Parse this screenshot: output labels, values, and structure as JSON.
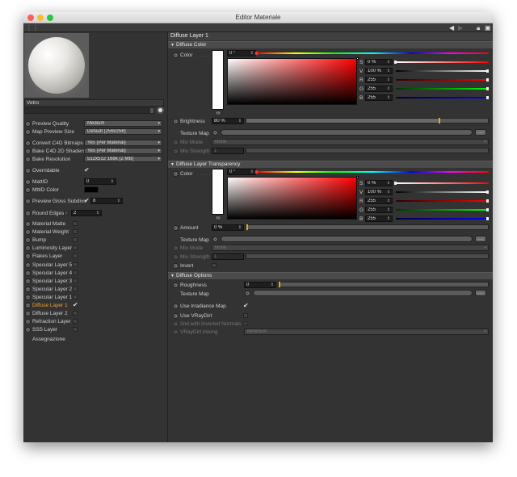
{
  "window": {
    "title": "Editor Materiale"
  },
  "material": {
    "name": "Vetro"
  },
  "left": {
    "preview_quality": {
      "label": "Preview Quality",
      "value": "Medium"
    },
    "map_preview_size": {
      "label": "Map Preview Size",
      "value": "Default (256x256)"
    },
    "convert_bitmaps": {
      "label": "Convert C4D Bitmaps",
      "value": "Yes (Per Material)"
    },
    "bake_shaders": {
      "label": "Bake C4D 2D Shaders",
      "value": "Yes (Per Material)"
    },
    "bake_resolution": {
      "label": "Bake Resolution",
      "value": "512x512    168k    (2 MB)"
    },
    "overridable": {
      "label": "Overridable"
    },
    "mattid": {
      "label": "MattID",
      "value": "0"
    },
    "mattid_color": {
      "label": "MttID Color"
    },
    "preview_gloss": {
      "label": "Preview Gloss Subdivs",
      "value": "8"
    },
    "round_edges": {
      "label": "Round Edges",
      "value": "2"
    },
    "layers": [
      {
        "label": "Material Matte",
        "checked": false,
        "active": false
      },
      {
        "label": "Material Weight",
        "checked": false,
        "active": false
      },
      {
        "label": "Bump",
        "checked": false,
        "active": false
      },
      {
        "label": "Luminosity Layer",
        "checked": false,
        "active": false
      },
      {
        "label": "Flakes Layer",
        "checked": false,
        "active": false
      },
      {
        "label": "Specular Layer 5",
        "checked": false,
        "active": false
      },
      {
        "label": "Specular Layer 4",
        "checked": false,
        "active": false
      },
      {
        "label": "Specular Layer 3",
        "checked": false,
        "active": false
      },
      {
        "label": "Specular Layer 2",
        "checked": false,
        "active": false
      },
      {
        "label": "Specular Layer 1",
        "checked": false,
        "active": false
      },
      {
        "label": "Diffuse Layer 1",
        "checked": true,
        "active": true
      },
      {
        "label": "Diffuse Layer 2",
        "checked": false,
        "active": false
      },
      {
        "label": "Refraction Layer",
        "checked": false,
        "active": false
      },
      {
        "label": "SSS Layer",
        "checked": false,
        "active": false
      }
    ],
    "assignment": "Assegnazione"
  },
  "panel": {
    "title": "Diffuse Layer 1",
    "diffuse_color": {
      "section": "Diffuse Color",
      "color_label": "Color",
      "hue": "0 °",
      "s": {
        "label": "S",
        "value": "0 %"
      },
      "v": {
        "label": "V",
        "value": "100 %"
      },
      "r": {
        "label": "R",
        "value": "255"
      },
      "g": {
        "label": "G",
        "value": "255"
      },
      "b": {
        "label": "B",
        "value": "255"
      },
      "brightness": {
        "label": "Brightness",
        "value": "80 %",
        "level": 0.8
      },
      "texture_map": "Texture Map",
      "mix_mode": {
        "label": "Mix Mode",
        "value": "None"
      },
      "mix_strength": {
        "label": "Mix Strength",
        "value": "1"
      }
    },
    "transparency": {
      "section": "Diffuse Layer Transparency",
      "color_label": "Color",
      "hue": "0 °",
      "s": {
        "label": "S",
        "value": "0 %"
      },
      "v": {
        "label": "V",
        "value": "100 %"
      },
      "r": {
        "label": "R",
        "value": "255"
      },
      "g": {
        "label": "G",
        "value": "255"
      },
      "b": {
        "label": "B",
        "value": "255"
      },
      "amount": {
        "label": "Amount",
        "value": "0 %",
        "level": 0
      },
      "texture_map": "Texture Map",
      "mix_mode": {
        "label": "Mix Mode",
        "value": "None"
      },
      "mix_strength": {
        "label": "Mix Strength",
        "value": "1"
      },
      "invert": "Invert"
    },
    "options": {
      "section": "Diffuse Options",
      "roughness": {
        "label": "Roughness",
        "value": "0",
        "level": 0
      },
      "texture_map": "Texture Map",
      "use_irradiance": "Use Irradiance Map",
      "use_vraydirt": "Use VRayDirt",
      "inverted_normals": "2nd with Inverted Normals",
      "vraydirt_mixing": {
        "label": "VRayDirt mixing",
        "value": "Minimum"
      }
    }
  },
  "colors": {
    "accent": "#f0a030",
    "bg": "#333333"
  }
}
